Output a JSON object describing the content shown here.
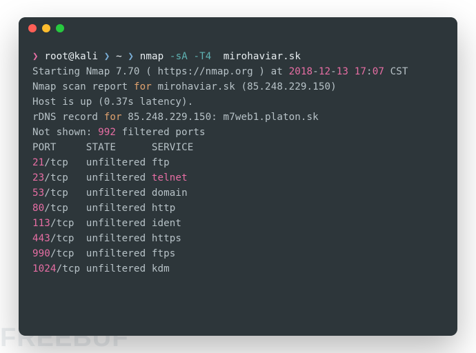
{
  "prompt": {
    "arrow": "❯",
    "user_host": "root@kali",
    "cwd": "~",
    "command": "nmap",
    "flags": "-sA -T4",
    "target": "mirohaviar.sk"
  },
  "output": {
    "starting_pre": "Starting Nmap 7.70 ( https://nmap.org ) at ",
    "starting_date_yr": "2018",
    "starting_dash1": "-",
    "starting_date_mo": "12",
    "starting_dash2": "-",
    "starting_date_dy": "13",
    "starting_sp": " ",
    "starting_time_h": "17",
    "starting_colon": ":",
    "starting_time_m": "07",
    "starting_tz": " CST",
    "scan_report_pre": "Nmap scan report ",
    "kw_for": "for",
    "scan_report_post": " mirohaviar.sk (85.248.229.150)",
    "host_up": "Host is up (0.37s latency).",
    "rdns_pre": "rDNS record ",
    "rdns_post": " 85.248.229.150: m7web1.platon.sk",
    "not_shown_pre": "Not shown: ",
    "not_shown_num": "992",
    "not_shown_post": " filtered ports",
    "header_port": "PORT",
    "header_state": "STATE",
    "header_service": "SERVICE",
    "rows": [
      {
        "port": "21",
        "proto": "/tcp   ",
        "state": "unfiltered",
        "svc": " ftp",
        "svc_hl": false
      },
      {
        "port": "23",
        "proto": "/tcp   ",
        "state": "unfiltered",
        "svc": " telnet",
        "svc_hl": true
      },
      {
        "port": "53",
        "proto": "/tcp   ",
        "state": "unfiltered",
        "svc": " domain",
        "svc_hl": false
      },
      {
        "port": "80",
        "proto": "/tcp   ",
        "state": "unfiltered",
        "svc": " http",
        "svc_hl": false
      },
      {
        "port": "113",
        "proto": "/tcp  ",
        "state": "unfiltered",
        "svc": " ident",
        "svc_hl": false
      },
      {
        "port": "443",
        "proto": "/tcp  ",
        "state": "unfiltered",
        "svc": " https",
        "svc_hl": false
      },
      {
        "port": "990",
        "proto": "/tcp  ",
        "state": "unfiltered",
        "svc": " ftps",
        "svc_hl": false
      },
      {
        "port": "1024",
        "proto": "/tcp ",
        "state": "unfiltered",
        "svc": " kdm",
        "svc_hl": false
      }
    ]
  },
  "watermark": "FREEBUF"
}
